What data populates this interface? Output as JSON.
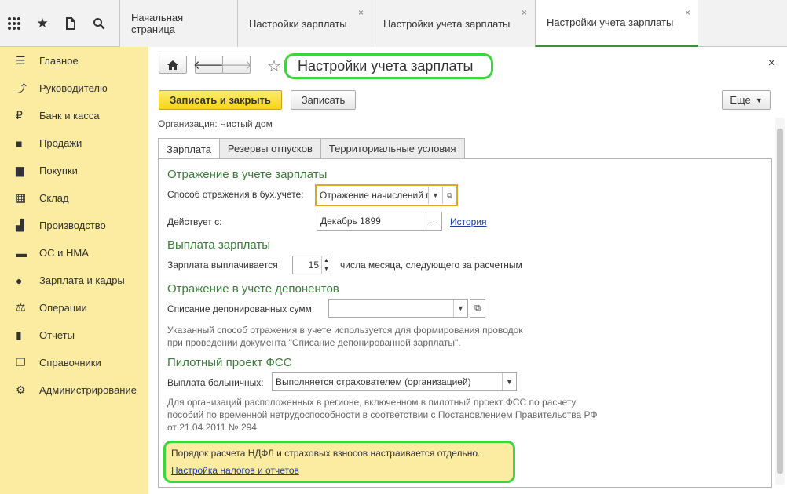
{
  "topbar": {
    "icons": [
      "apps-grid-icon",
      "star-icon",
      "history-icon",
      "search-icon"
    ],
    "tabs": [
      {
        "label": "Начальная страница",
        "closable": false,
        "active": false
      },
      {
        "label": "Настройки зарплаты",
        "closable": true,
        "active": false
      },
      {
        "label": "Настройки учета зарплаты",
        "closable": true,
        "active": false
      },
      {
        "label": "Настройки учета зарплаты",
        "closable": true,
        "active": true
      }
    ],
    "close_glyph": "×"
  },
  "sidebar": {
    "items": [
      {
        "label": "Главное",
        "icon": "menu-lines-icon"
      },
      {
        "label": "Руководителю",
        "icon": "trend-icon"
      },
      {
        "label": "Банк и касса",
        "icon": "ruble-icon"
      },
      {
        "label": "Продажи",
        "icon": "bag-icon"
      },
      {
        "label": "Покупки",
        "icon": "cart-icon"
      },
      {
        "label": "Склад",
        "icon": "warehouse-icon"
      },
      {
        "label": "Производство",
        "icon": "factory-icon"
      },
      {
        "label": "ОС и НМА",
        "icon": "truck-icon"
      },
      {
        "label": "Зарплата и кадры",
        "icon": "people-icon"
      },
      {
        "label": "Операции",
        "icon": "operations-icon"
      },
      {
        "label": "Отчеты",
        "icon": "bar-chart-icon"
      },
      {
        "label": "Справочники",
        "icon": "books-icon"
      },
      {
        "label": "Администрирование",
        "icon": "gear-icon"
      }
    ]
  },
  "form": {
    "title": "Настройки учета зарплаты",
    "close_glyph": "×",
    "toolbar": {
      "save_close": "Записать и закрыть",
      "save": "Записать",
      "more": "Еще"
    },
    "organization": "Организация: Чистый дом",
    "tabs": [
      "Зарплата",
      "Резервы отпусков",
      "Территориальные условия"
    ],
    "sections": {
      "accounting": {
        "header": "Отражение в учете зарплаты",
        "method_label": "Способ отражения в бух.учете:",
        "method_value": "Отражение начислений п",
        "effective_label": "Действует с:",
        "effective_value": "Декабрь 1899",
        "history_link": "История"
      },
      "payment": {
        "header": "Выплата зарплаты",
        "label": "Зарплата выплачивается",
        "day_value": "15",
        "suffix": "числа месяца, следующего за расчетным"
      },
      "deposits": {
        "header": "Отражение в учете депонентов",
        "label": "Списание депонированных сумм:",
        "value": "",
        "note_line1": "Указанный способ отражения в учете используется для формирования проводок",
        "note_line2": "при проведении документа \"Списание депонированной зарплаты\"."
      },
      "fss": {
        "header": "Пилотный проект ФСС",
        "label": "Выплата больничных:",
        "value": "Выполняется страхователем (организацией)",
        "note_line1": "Для организаций расположенных в регионе, включенном в пилотный проект ФСС по расчету",
        "note_line2": "пособий по временной нетрудоспособности в соответствии с Постановлением Правительства РФ",
        "note_line3": "от 21.04.2011 № 294"
      },
      "info": {
        "text": "Порядок расчета НДФЛ и страховых взносов настраивается отдельно.",
        "link": "Настройка налогов и отчетов"
      }
    }
  },
  "colors": {
    "sidebar_bg": "#fbeca2",
    "accent_green": "#3cd63c",
    "section_header": "#3a7d3a",
    "primary_button": "#f5d41a",
    "link": "#1a3fa0",
    "highlight_border": "#e0a820"
  }
}
